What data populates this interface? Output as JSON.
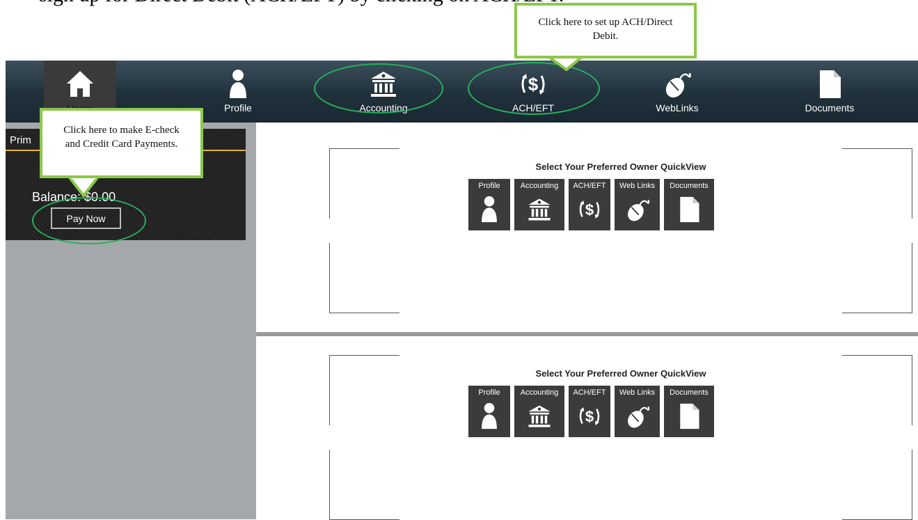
{
  "caption": "sign up for Direct Debit (ACH/EFT) by clicking on ACH/EFT.",
  "nav": {
    "items": [
      {
        "label": "Home",
        "icon": "home-icon"
      },
      {
        "label": "Profile",
        "icon": "person-icon"
      },
      {
        "label": "Accounting",
        "icon": "bank-icon"
      },
      {
        "label": "ACH/EFT",
        "icon": "dollar-cycle-icon"
      },
      {
        "label": "WebLinks",
        "icon": "mouse-icon"
      },
      {
        "label": "Documents",
        "icon": "document-icon"
      }
    ]
  },
  "account": {
    "title": "Prim",
    "balance": "Balance: $0.00",
    "pay_now": "Pay Now"
  },
  "quickview": {
    "title": "Select Your Preferred Owner QuickView",
    "tiles": [
      "Profile",
      "Accounting",
      "ACH/EFT",
      "Web Links",
      "Documents"
    ]
  },
  "callouts": {
    "ach": "Click here to set up ACH/Direct Debit.",
    "pay": "Click here to make E-check and Credit Card Payments."
  },
  "colors": {
    "callout_border": "#8cc84b",
    "highlight_ellipse": "#27b05a",
    "account_accent": "#e8b52a"
  }
}
